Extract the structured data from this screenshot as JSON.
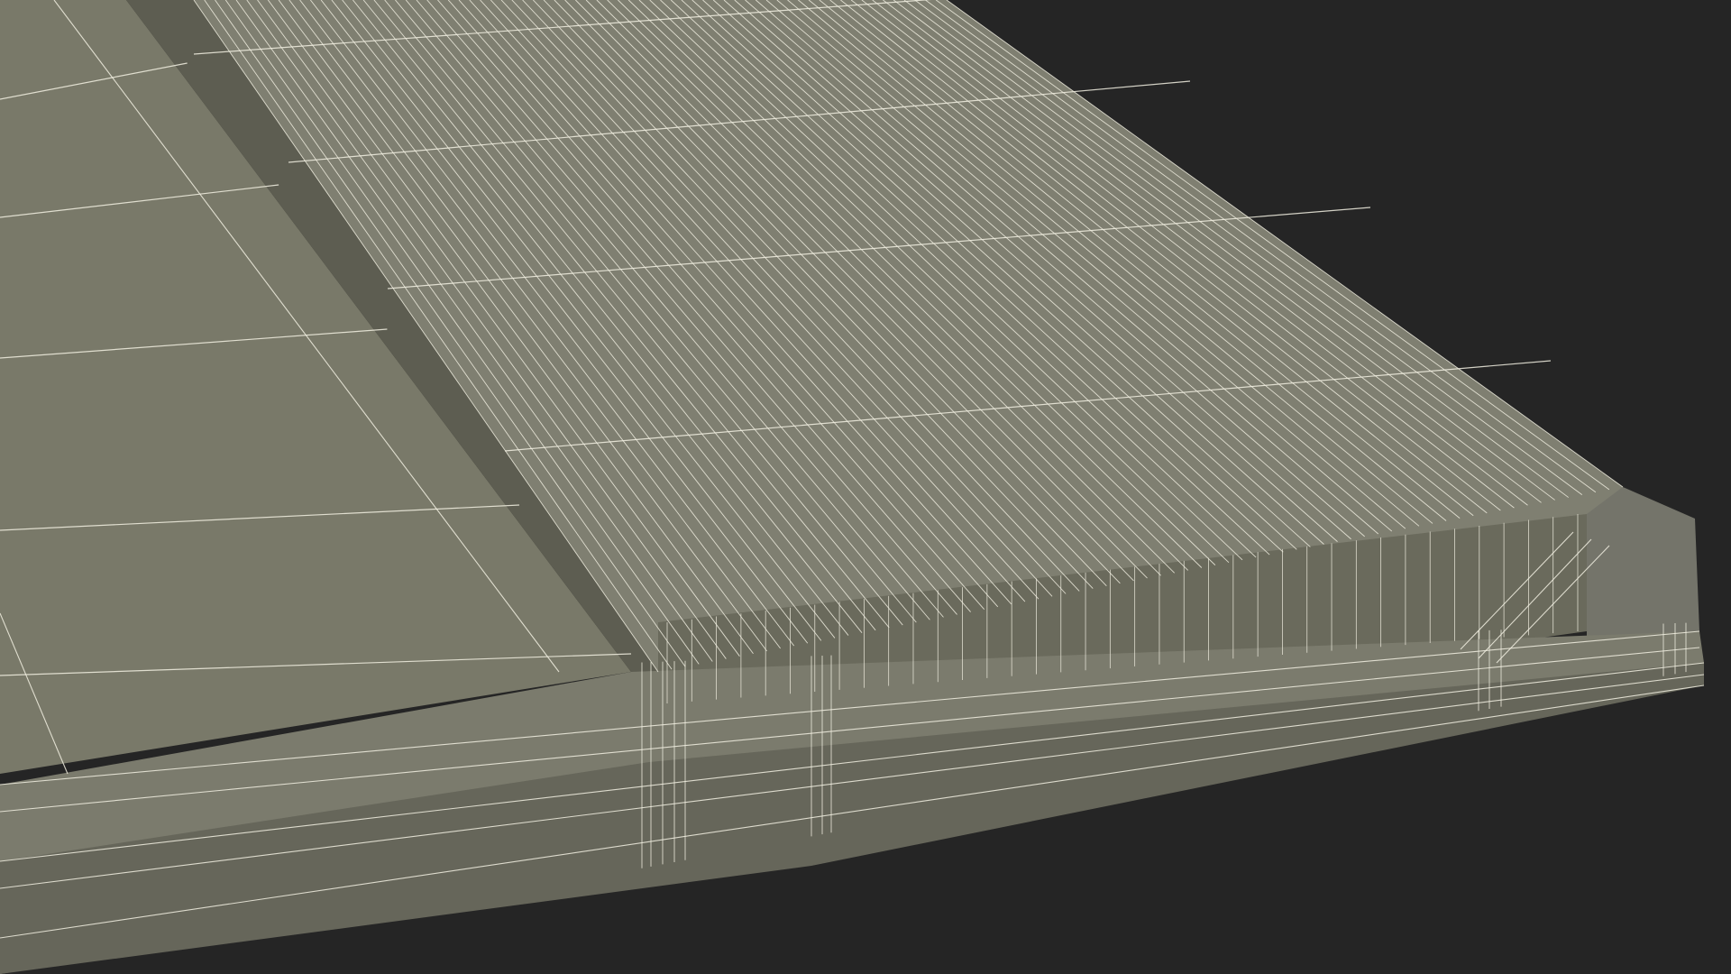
{
  "scene": {
    "background_color": "#252525",
    "surface_color": "#7a7a6c",
    "surface_light": "#858577",
    "surface_shadow": "#5c5c50",
    "wire_color": "#f2f0e2",
    "corrugation_line_count": 72,
    "grid_row_count": 5
  }
}
